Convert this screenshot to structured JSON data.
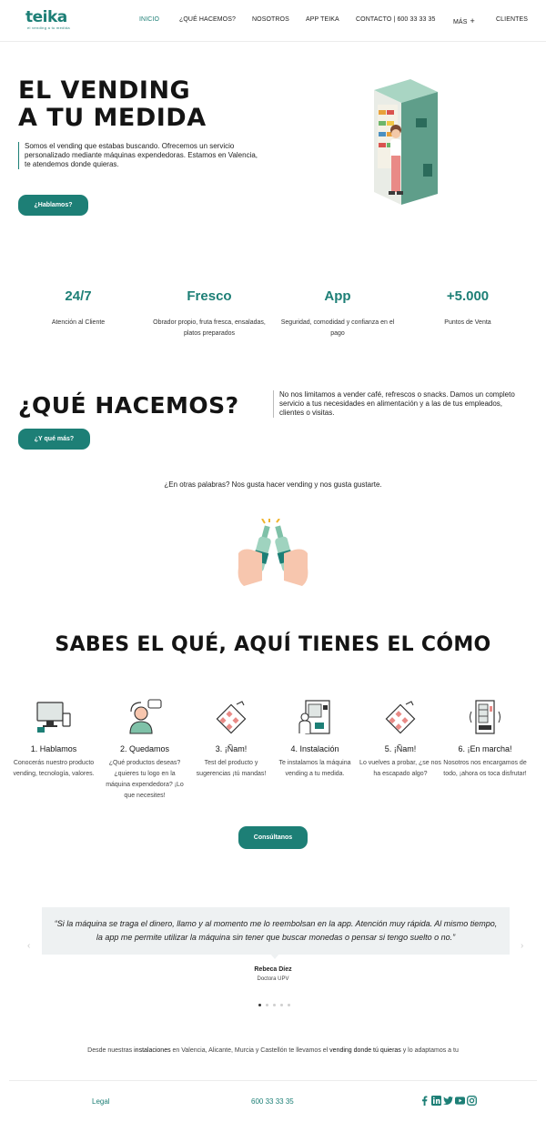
{
  "header": {
    "logo": "teika",
    "logo_tagline": "el vending a tu medida",
    "nav": [
      {
        "label": "INICIO"
      },
      {
        "label": "¿QUÉ HACEMOS?"
      },
      {
        "label": "NOSOTROS"
      },
      {
        "label": "APP TEIKA"
      },
      {
        "label": "CONTACTO | 600 33 33 35"
      },
      {
        "label": "MÁS"
      },
      {
        "label": "CLIENTES"
      }
    ],
    "more_icon": "+"
  },
  "hero": {
    "title_line1": "EL VENDING",
    "title_line2": "A TU MEDIDA",
    "text": "Somos el vending que estabas buscando. Ofrecemos un servicio personalizado mediante máquinas expendedoras. Estamos en Valencia, te atendemos donde quieras.",
    "button": "¿Hablamos?",
    "illustration": "vending-machine-illustration"
  },
  "stats": [
    {
      "value": "24/7",
      "desc": "Atención al Cliente"
    },
    {
      "value": "Fresco",
      "desc": "Obrador propio, fruta fresca, ensaladas, platos preparados"
    },
    {
      "value": "App",
      "desc": "Seguridad, comodidad y confianza en el pago"
    },
    {
      "value": "+5.000",
      "desc": "Puntos de Venta"
    }
  ],
  "que_hacemos": {
    "title": "¿QUÉ HACEMOS?",
    "text": "No nos limitamos a vender café, refrescos o snacks. Damos un completo servicio a tus necesidades en alimentación y a las de tus empleados, clientes o visitas.",
    "button": "¿Y qué más?",
    "tagline": "¿En otras palabras? Nos gusta hacer vending y nos gusta gustarte.",
    "illustration": "cheers-bottles-illustration"
  },
  "como": {
    "title": "SABES EL QUÉ, AQUÍ TIENES EL CÓMO",
    "steps": [
      {
        "icon": "devices-icon",
        "title": "1. Hablamos",
        "desc": "Conocerás nuestro producto vending, tecnología, valores."
      },
      {
        "icon": "conversation-icon",
        "title": "2. Quedamos",
        "desc": "¿Qué productos deseas? ¿quieres tu logo en la máquina expendedora? ¡Lo que necesites!"
      },
      {
        "icon": "chocolate-bar-icon",
        "title": "3. ¡Ñam!",
        "desc": "Test del producto y sugerencias ¡tú mandas!"
      },
      {
        "icon": "installing-machine-icon",
        "title": "4. Instalación",
        "desc": "Te instalamos la máquina vending a tu medida."
      },
      {
        "icon": "chocolate-bar-icon",
        "title": "5. ¡Ñam!",
        "desc": "Lo vuelves a probar, ¿se nos ha escapado algo?"
      },
      {
        "icon": "vending-machine-icon",
        "title": "6. ¡En marcha!",
        "desc": "Nosotros nos encargamos de todo, ¡ahora os toca disfrutar!"
      }
    ],
    "button": "Consúltanos"
  },
  "testimonial": {
    "quote": "“Si la máquina se traga el dinero, llamo y al momento me lo reembolsan en la app. Atención muy rápida. Al mismo tiempo, la app me permite utilizar la máquina sin tener que buscar monedas o pensar si tengo suelto o no.”",
    "name": "Rebeca Díez",
    "role": "Doctora UPV",
    "prev": "‹",
    "next": "›",
    "dots": 5,
    "active_dot": 0
  },
  "bottom": {
    "part1": "Desde nuestras ",
    "part2": "instalaciones",
    "part3": " en Valencia, Alicante, Murcia y Castellón te llevamos el ",
    "part4": "vending donde tú quieras",
    "part5": " y lo adaptamos a tu"
  },
  "footer": {
    "legal": "Legal",
    "phone": "600 33 33 35",
    "social": [
      "facebook-icon",
      "linkedin-icon",
      "twitter-icon",
      "youtube-icon",
      "instagram-icon"
    ]
  },
  "colors": {
    "accent": "#1d7f76",
    "testimonial_bg": "#eef1f2"
  }
}
